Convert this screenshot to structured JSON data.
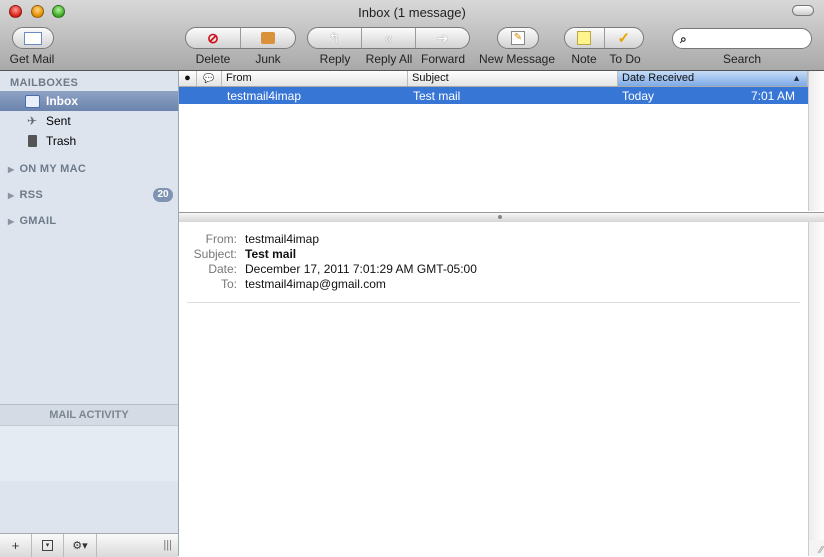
{
  "window": {
    "title": "Inbox (1 message)"
  },
  "toolbar": {
    "get_mail": "Get Mail",
    "delete": "Delete",
    "junk": "Junk",
    "reply": "Reply",
    "reply_all": "Reply All",
    "forward": "Forward",
    "new_message": "New Message",
    "note": "Note",
    "todo": "To Do",
    "search_label": "Search",
    "search_value": ""
  },
  "sidebar": {
    "mailboxes_header": "MAILBOXES",
    "items": [
      {
        "label": "Inbox",
        "icon": "inbox-icon",
        "selected": true
      },
      {
        "label": "Sent",
        "icon": "sent-icon"
      },
      {
        "label": "Trash",
        "icon": "trash-icon"
      }
    ],
    "groups": [
      {
        "label": "ON MY MAC"
      },
      {
        "label": "RSS",
        "badge": "20"
      },
      {
        "label": "GMAIL"
      }
    ],
    "activity_header": "MAIL ACTIVITY",
    "bottom_buttons": [
      "+",
      "▾",
      "⚙▾"
    ]
  },
  "message_list": {
    "columns": [
      "From",
      "Subject",
      "Date Received"
    ],
    "sort_indicator": "▲",
    "rows": [
      {
        "from": "testmail4imap",
        "subject": "Test mail",
        "date": "Today",
        "time": "7:01 AM"
      }
    ]
  },
  "preview": {
    "from_label": "From:",
    "from": "testmail4imap",
    "subject_label": "Subject:",
    "subject": "Test mail",
    "date_label": "Date:",
    "date": "December 17, 2011 7:01:29 AM GMT-05:00",
    "to_label": "To:",
    "to": "testmail4imap@gmail.com"
  },
  "colors": {
    "selection": "#3876d6",
    "sidebar_bg": "#dde4ee",
    "badge": "#7f93b3"
  }
}
